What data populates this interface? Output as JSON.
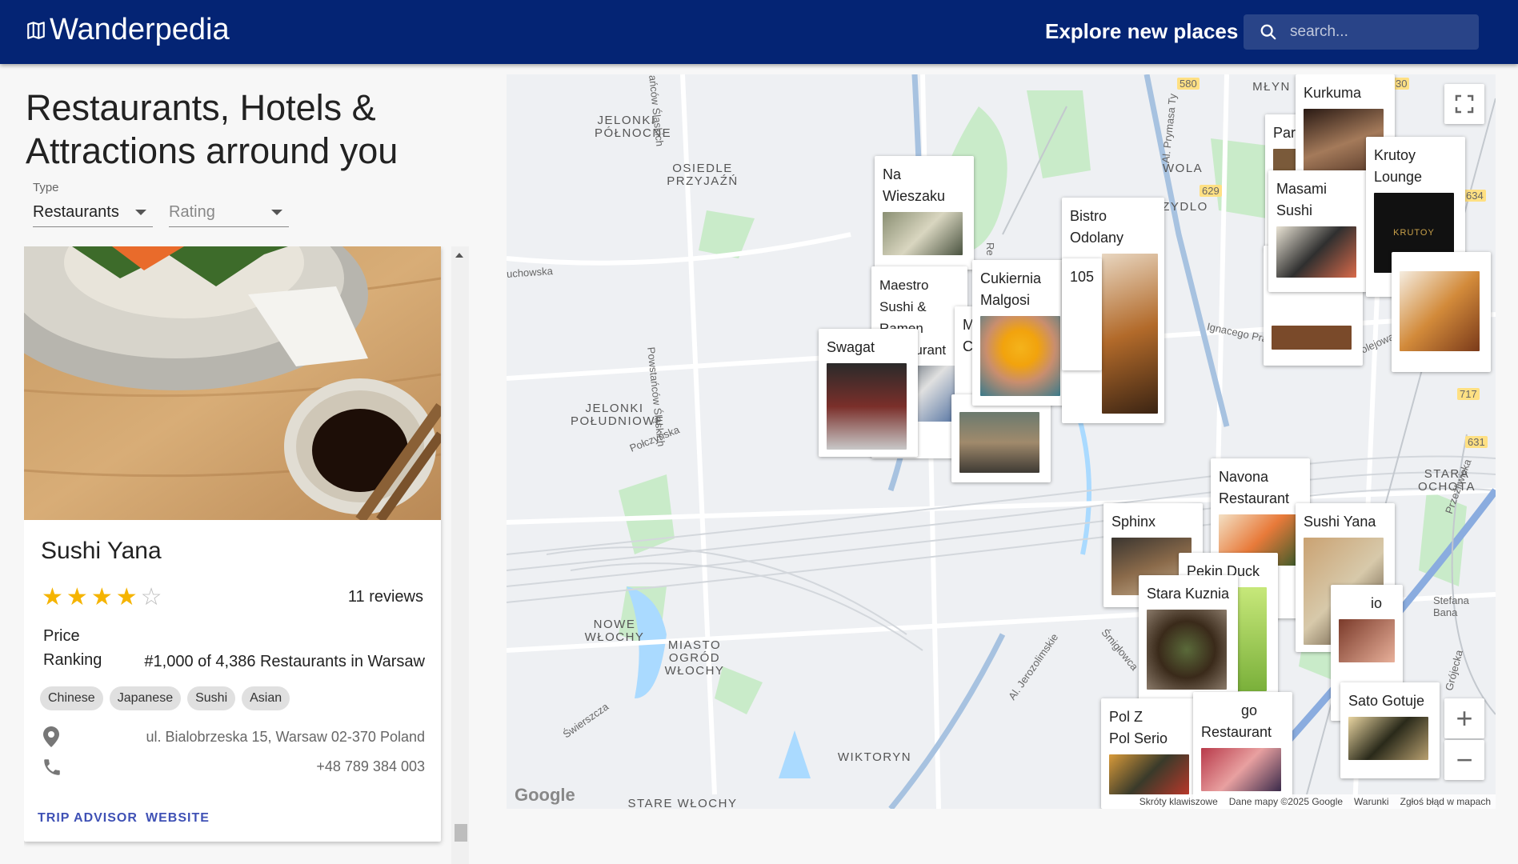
{
  "header": {
    "brand": "Wanderpedia",
    "explore": "Explore new places",
    "search_placeholder": "search..."
  },
  "main": {
    "heading": "Restaurants, Hotels & Attractions arround you",
    "type_label": "Type",
    "type_value": "Restaurants",
    "rating_placeholder": "Rating"
  },
  "card": {
    "name": "Sushi Yana",
    "rating": 4,
    "max_rating": 5,
    "reviews": "11 reviews",
    "price_label": "Price",
    "ranking_label": "Ranking",
    "ranking_value": "#1,000 of 4,386 Restaurants in Warsaw",
    "cuisines": [
      "Chinese",
      "Japanese",
      "Sushi",
      "Asian"
    ],
    "address": "ul. Bialobrzeska 15, Warsaw 02-370 Poland",
    "phone": "+48 789 384 003",
    "trip_advisor": "TRIP ADVISOR",
    "website": "WEBSITE"
  },
  "map": {
    "places": [
      "Na Wieszaku",
      "Maestro Sushi & Ramen Restaurant",
      "Swagat",
      "Cukiernia Malgosi",
      "Bistro Odolany",
      "105",
      "Kurkuma",
      "Krutoy Lounge",
      "Masami Sushi",
      "Navona Restaurant",
      "Sphinx",
      "Pekin Duck",
      "Stara Kuznia",
      "Sushi Yana",
      "Pol Serio",
      "Sato Gotuje",
      "Par",
      "M",
      "Cr",
      "Pol Z",
      "go",
      "Restaurant",
      "io"
    ],
    "districts": [
      "JELONKI PÓŁNOCNE",
      "OSIEDLE PRZYJAŹŃ",
      "JELONKI POŁUDNIOWE",
      "NOWE WŁOCHY",
      "MIASTO OGRÓD WŁOCHY",
      "WIKTORYN",
      "STARE WŁOCHY",
      "STARA OCHOTA",
      "WOLA",
      "ZYDLO",
      "MŁYN"
    ],
    "streets": [
      "uchowska",
      "Powstańców Śląskich",
      "Połczyńska",
      "Ignacego Prądzyńskiego",
      "Kolejowa",
      "Al. Jerozolimskie",
      "Śmigłowca",
      "Świerszcza",
      "Stefana Bana",
      "Grójecka",
      "Al. Prymasa Ty",
      "ańców Śląskich",
      "Re",
      "Przeźliwicka",
      "Kolejowa"
    ],
    "road_badges": [
      "580",
      "629",
      "634",
      "717",
      "631",
      "30"
    ],
    "footer": {
      "shortcuts": "Skróty klawiszowe",
      "data": "Dane mapy ©2025 Google",
      "terms": "Warunki",
      "report": "Zgłoś błąd w mapach"
    },
    "google_logo": "Google",
    "zoom_in": "+",
    "zoom_out": "−"
  },
  "colors": {
    "appbar": "#042474",
    "accent_link": "#3f51b5",
    "star": "#f5b400"
  }
}
